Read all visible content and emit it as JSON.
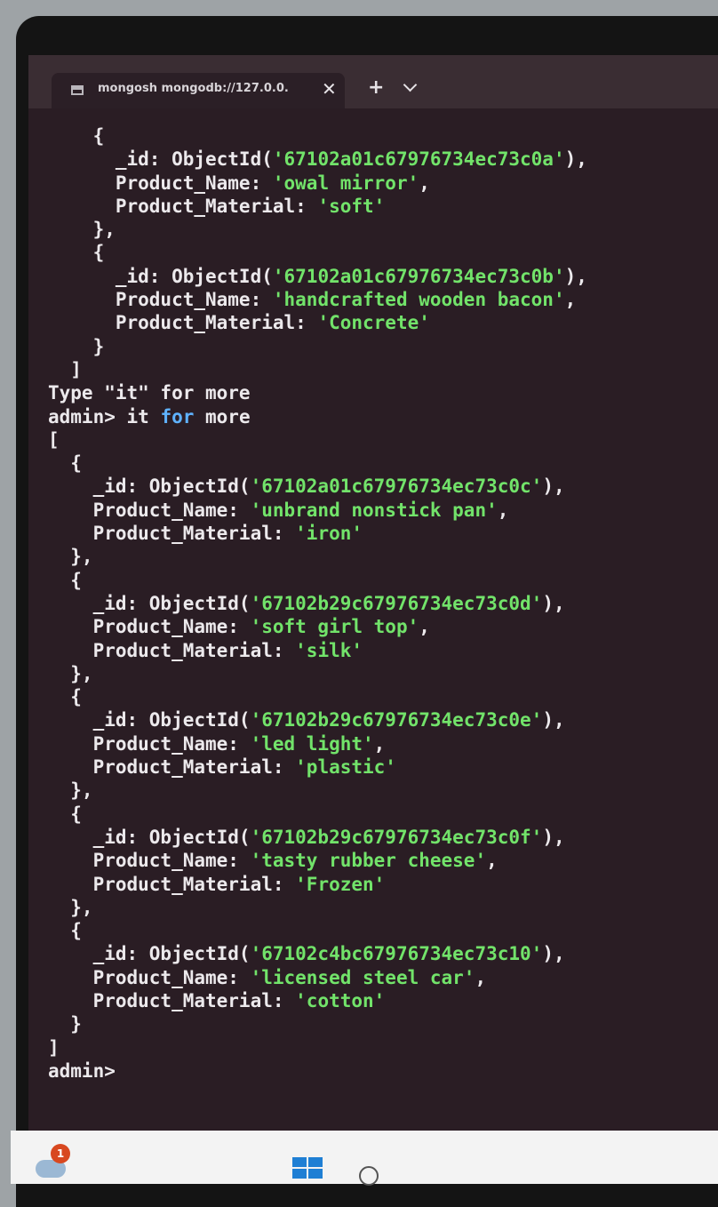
{
  "window": {
    "tab_title": "mongosh mongodb://127.0.0.",
    "close_glyph": "✕",
    "new_tab_glyph": "+"
  },
  "terminal": {
    "lines": [
      "    {",
      "      _id: ObjectId('67102a01c67976734ec73c0a'),",
      "      Product_Name: 'owal mirror',",
      "      Product_Material: 'soft'",
      "    },",
      "    {",
      "      _id: ObjectId('67102a01c67976734ec73c0b'),",
      "      Product_Name: 'handcrafted wooden bacon',",
      "      Product_Material: 'Concrete'",
      "    }",
      "  ]",
      "Type \"it\" for more",
      "admin> it for more",
      "[",
      "  {",
      "    _id: ObjectId('67102a01c67976734ec73c0c'),",
      "    Product_Name: 'unbrand nonstick pan',",
      "    Product_Material: 'iron'",
      "  },",
      "  {",
      "    _id: ObjectId('67102b29c67976734ec73c0d'),",
      "    Product_Name: 'soft girl top',",
      "    Product_Material: 'silk'",
      "  },",
      "  {",
      "    _id: ObjectId('67102b29c67976734ec73c0e'),",
      "    Product_Name: 'led light',",
      "    Product_Material: 'plastic'",
      "  },",
      "  {",
      "    _id: ObjectId('67102b29c67976734ec73c0f'),",
      "    Product_Name: 'tasty rubber cheese',",
      "    Product_Material: 'Frozen'",
      "  },",
      "  {",
      "    _id: ObjectId('67102c4bc67976734ec73c10'),",
      "    Product_Name: 'licensed steel car',",
      "    Product_Material: 'cotton'",
      "  }",
      "]",
      "admin>"
    ]
  },
  "taskbar": {
    "notification_count": "1"
  },
  "colors": {
    "terminal_bg": "#2a1d24",
    "string": "#72e36a",
    "keyword": "#5fb2ff",
    "text": "#ece9ec"
  }
}
